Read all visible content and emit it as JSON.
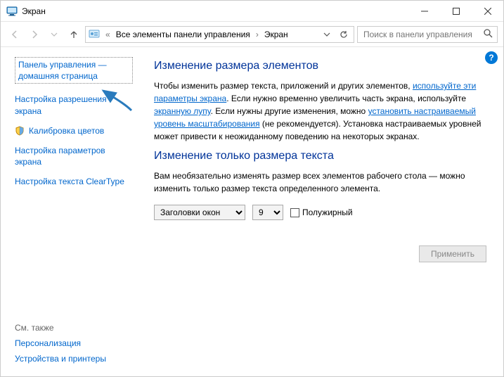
{
  "window": {
    "title": "Экран"
  },
  "breadcrumb": {
    "root": "Все элементы панели управления",
    "current": "Экран"
  },
  "search": {
    "placeholder": "Поиск в панели управления"
  },
  "sidebar": {
    "home": "Панель управления — домашняя страница",
    "items": [
      {
        "label": "Настройка разрешения экрана",
        "shield": false
      },
      {
        "label": "Калибровка цветов",
        "shield": true
      },
      {
        "label": "Настройка параметров экрана",
        "shield": false
      },
      {
        "label": "Настройка текста ClearType",
        "shield": false
      }
    ],
    "see_also_heading": "См. также",
    "see_also": [
      "Персонализация",
      "Устройства и принтеры"
    ]
  },
  "main": {
    "h1": "Изменение размера элементов",
    "p1_a": "Чтобы изменить размер текста, приложений и других элементов, ",
    "p1_link1": "используйте эти параметры экрана",
    "p1_b": ". Если нужно временно увеличить часть экрана, используйте ",
    "p1_link2": "экранную лупу",
    "p1_c": ". Если нужны другие изменения, можно ",
    "p1_link3": "установить настраиваемый уровень масштабирования",
    "p1_d": " (не рекомендуется). Установка настраиваемых уровней может привести к неожиданному поведению на некоторых экранах.",
    "h2": "Изменение только размера текста",
    "p2": "Вам необязательно изменять размер всех элементов рабочего стола — можно изменить только размер текста определенного элемента.",
    "select_item": "Заголовки окон",
    "select_size": "9",
    "bold_label": "Полужирный",
    "apply": "Применить"
  },
  "help": "?"
}
